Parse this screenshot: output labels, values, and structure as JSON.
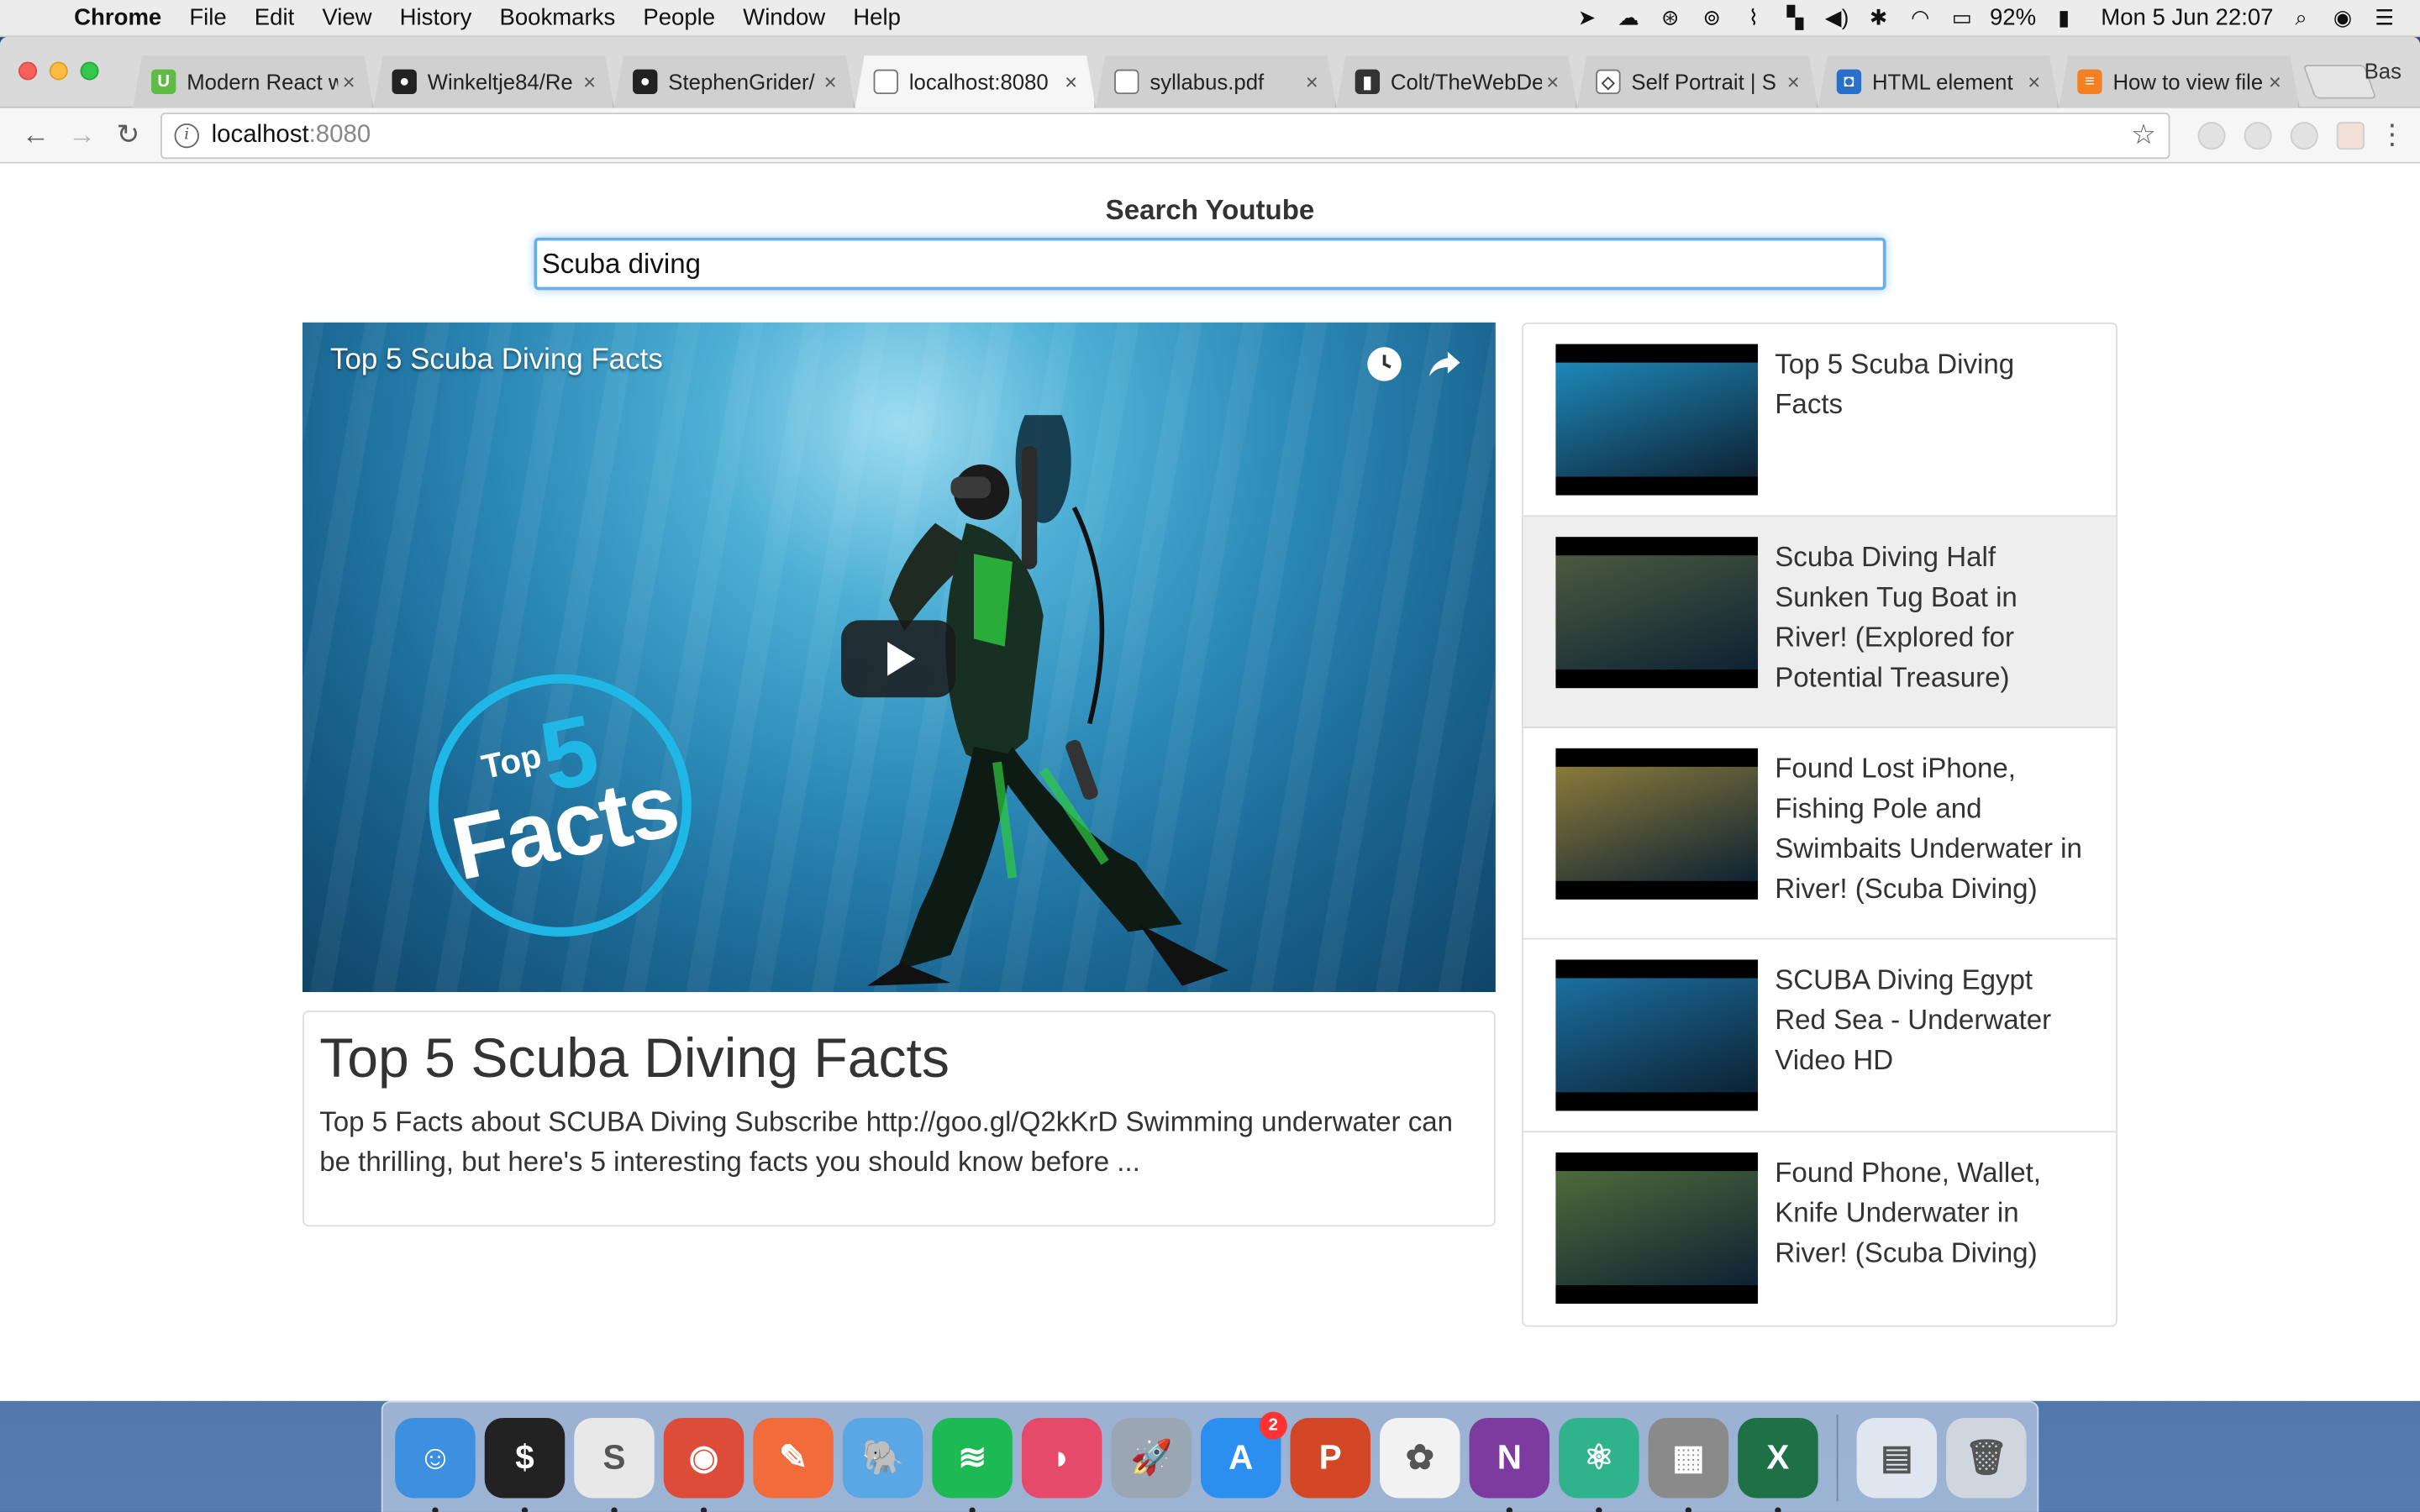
{
  "menubar": {
    "app_name": "Chrome",
    "items": [
      "File",
      "Edit",
      "View",
      "History",
      "Bookmarks",
      "People",
      "Window",
      "Help"
    ],
    "battery": "92%",
    "clock": "Mon 5 Jun  22:07"
  },
  "browser": {
    "tabs": [
      {
        "title": "Modern React w",
        "icon": "udemy-icon",
        "color": "#5fbb46",
        "glyph": "U"
      },
      {
        "title": "Winkeltje84/Re",
        "icon": "github-icon",
        "color": "#222222",
        "glyph": "●"
      },
      {
        "title": "StephenGrider/",
        "icon": "github-icon",
        "color": "#222222",
        "glyph": "●"
      },
      {
        "title": "localhost:8080",
        "icon": "page-icon",
        "color": "#ffffff",
        "glyph": ""
      },
      {
        "title": "syllabus.pdf",
        "icon": "page-icon",
        "color": "#ffffff",
        "glyph": ""
      },
      {
        "title": "Colt/TheWebDe",
        "icon": "code-icon",
        "color": "#333333",
        "glyph": "▮"
      },
      {
        "title": "Self Portrait | S",
        "icon": "codepen-icon",
        "color": "#ffffff",
        "glyph": "◇"
      },
      {
        "title": "HTML element",
        "icon": "docs-icon",
        "color": "#2a6fc9",
        "glyph": "◘"
      },
      {
        "title": "How to view file",
        "icon": "stackoverflow-icon",
        "color": "#f48024",
        "glyph": "≡"
      }
    ],
    "profile_label": "Bas",
    "url_host": "localhost",
    "url_port": ":8080"
  },
  "app": {
    "search_label": "Search Youtube",
    "search_value": "Scuba diving",
    "player": {
      "title": "Top 5 Scuba Diving Facts",
      "badge_top": "Top",
      "badge_number": "5",
      "badge_word": "Facts"
    },
    "detail": {
      "title": "Top 5 Scuba Diving Facts",
      "description": "Top 5 Facts about SCUBA Diving Subscribe http://goo.gl/Q2kKrD Swimming underwater can be thrilling, but here's 5 interesting facts you should know before ..."
    },
    "videos": [
      {
        "title": "Top 5 Scuba Diving Facts",
        "thumb": "#1e88b8"
      },
      {
        "title": "Scuba Diving Half Sunken Tug Boat in River! (Explored for Potential Treasure)",
        "thumb": "#4b5a3f"
      },
      {
        "title": "Found Lost iPhone, Fishing Pole and Swimbaits Underwater in River! (Scuba Diving)",
        "thumb": "#8a7a3a"
      },
      {
        "title": "SCUBA Diving Egypt Red Sea - Underwater Video HD",
        "thumb": "#1b6fa0"
      },
      {
        "title": "Found Phone, Wallet, Knife Underwater in River! (Scuba Diving)",
        "thumb": "#4f6a3a"
      }
    ]
  },
  "dock": {
    "apps": [
      {
        "name": "finder-icon",
        "color": "#3d8fe0",
        "glyph": "☺"
      },
      {
        "name": "terminal-icon",
        "color": "#222222",
        "glyph": "$"
      },
      {
        "name": "slack-icon",
        "color": "#e8e8e8",
        "glyph": "S"
      },
      {
        "name": "chrome-icon",
        "color": "#dd4b39",
        "glyph": "◉"
      },
      {
        "name": "pencil-icon",
        "color": "#f26b3a",
        "glyph": "✎"
      },
      {
        "name": "tableplus-icon",
        "color": "#5aa7e6",
        "glyph": "🐘"
      },
      {
        "name": "spotify-icon",
        "color": "#1db954",
        "glyph": "≋"
      },
      {
        "name": "lips-icon",
        "color": "#e64a6a",
        "glyph": "◗"
      },
      {
        "name": "launchpad-icon",
        "color": "#9aa6b4",
        "glyph": "🚀"
      },
      {
        "name": "app-store-icon",
        "color": "#2b8ff0",
        "glyph": "A",
        "badge": "2"
      },
      {
        "name": "powerpoint-icon",
        "color": "#d24726",
        "glyph": "P"
      },
      {
        "name": "photos-icon",
        "color": "#f2f2f2",
        "glyph": "✿"
      },
      {
        "name": "onenote-icon",
        "color": "#7d3b9f",
        "glyph": "N"
      },
      {
        "name": "atom-icon",
        "color": "#2fb38a",
        "glyph": "⚛"
      },
      {
        "name": "calculator-icon",
        "color": "#8a8a8a",
        "glyph": "▦"
      },
      {
        "name": "excel-icon",
        "color": "#1e7145",
        "glyph": "X"
      },
      {
        "name": "document-stack-icon",
        "color": "#dfe6ef",
        "glyph": "▤"
      },
      {
        "name": "trash-icon",
        "color": "#cfd6de",
        "glyph": "🗑"
      }
    ]
  }
}
